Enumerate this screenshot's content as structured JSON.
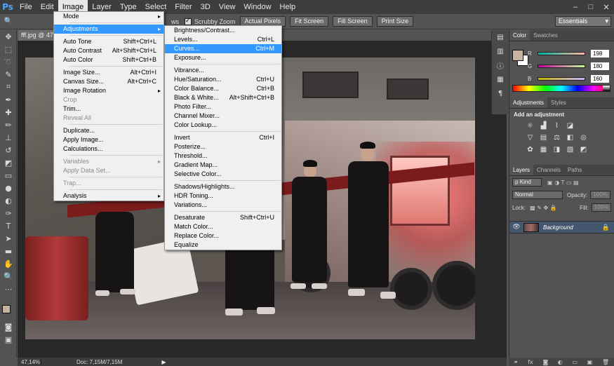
{
  "app": {
    "logo": "Ps"
  },
  "menubar": [
    "File",
    "Edit",
    "Image",
    "Layer",
    "Type",
    "Select",
    "Filter",
    "3D",
    "View",
    "Window",
    "Help"
  ],
  "window_controls": [
    "–",
    "□",
    "✕"
  ],
  "options_bar": {
    "zoom_text": "ws",
    "scrubby_zoom": "Scrubby Zoom",
    "buttons": [
      "Actual Pixels",
      "Fit Screen",
      "Fill Screen",
      "Print Size"
    ],
    "workspace": "Essentials"
  },
  "document_tab": "fff.jpg @ 47",
  "image_menu": {
    "items": [
      {
        "label": "Mode",
        "shortcut": "",
        "submenu": true
      },
      {
        "sep": true
      },
      {
        "label": "Adjustments",
        "shortcut": "",
        "submenu": true,
        "highlight": true
      },
      {
        "sep": true
      },
      {
        "label": "Auto Tone",
        "shortcut": "Shift+Ctrl+L"
      },
      {
        "label": "Auto Contrast",
        "shortcut": "Alt+Shift+Ctrl+L"
      },
      {
        "label": "Auto Color",
        "shortcut": "Shift+Ctrl+B"
      },
      {
        "sep": true
      },
      {
        "label": "Image Size...",
        "shortcut": "Alt+Ctrl+I"
      },
      {
        "label": "Canvas Size...",
        "shortcut": "Alt+Ctrl+C"
      },
      {
        "label": "Image Rotation",
        "shortcut": "",
        "submenu": true
      },
      {
        "label": "Crop",
        "shortcut": "",
        "disabled": true
      },
      {
        "label": "Trim...",
        "shortcut": ""
      },
      {
        "label": "Reveal All",
        "shortcut": "",
        "disabled": true
      },
      {
        "sep": true
      },
      {
        "label": "Duplicate...",
        "shortcut": ""
      },
      {
        "label": "Apply Image...",
        "shortcut": ""
      },
      {
        "label": "Calculations...",
        "shortcut": ""
      },
      {
        "sep": true
      },
      {
        "label": "Variables",
        "shortcut": "",
        "submenu": true,
        "disabled": true
      },
      {
        "label": "Apply Data Set...",
        "shortcut": "",
        "disabled": true
      },
      {
        "sep": true
      },
      {
        "label": "Trap...",
        "shortcut": "",
        "disabled": true
      },
      {
        "sep": true
      },
      {
        "label": "Analysis",
        "shortcut": "",
        "submenu": true
      }
    ]
  },
  "adjustments_menu": {
    "items": [
      {
        "label": "Brightness/Contrast...",
        "shortcut": ""
      },
      {
        "label": "Levels...",
        "shortcut": "Ctrl+L"
      },
      {
        "label": "Curves...",
        "shortcut": "Ctrl+M",
        "highlight": true
      },
      {
        "label": "Exposure...",
        "shortcut": ""
      },
      {
        "sep": true
      },
      {
        "label": "Vibrance...",
        "shortcut": ""
      },
      {
        "label": "Hue/Saturation...",
        "shortcut": "Ctrl+U"
      },
      {
        "label": "Color Balance...",
        "shortcut": "Ctrl+B"
      },
      {
        "label": "Black & White...",
        "shortcut": "Alt+Shift+Ctrl+B"
      },
      {
        "label": "Photo Filter...",
        "shortcut": ""
      },
      {
        "label": "Channel Mixer...",
        "shortcut": ""
      },
      {
        "label": "Color Lookup...",
        "shortcut": ""
      },
      {
        "sep": true
      },
      {
        "label": "Invert",
        "shortcut": "Ctrl+I"
      },
      {
        "label": "Posterize...",
        "shortcut": ""
      },
      {
        "label": "Threshold...",
        "shortcut": ""
      },
      {
        "label": "Gradient Map...",
        "shortcut": ""
      },
      {
        "label": "Selective Color...",
        "shortcut": ""
      },
      {
        "sep": true
      },
      {
        "label": "Shadows/Highlights...",
        "shortcut": ""
      },
      {
        "label": "HDR Toning...",
        "shortcut": ""
      },
      {
        "label": "Variations...",
        "shortcut": ""
      },
      {
        "sep": true
      },
      {
        "label": "Desaturate",
        "shortcut": "Shift+Ctrl+U"
      },
      {
        "label": "Match Color...",
        "shortcut": ""
      },
      {
        "label": "Replace Color...",
        "shortcut": ""
      },
      {
        "label": "Equalize",
        "shortcut": ""
      }
    ]
  },
  "status_bar": {
    "zoom": "47,14%",
    "doc": "Doc: 7,15M/7,15M",
    "arrow": "▶"
  },
  "color_panel": {
    "tabs": [
      "Color",
      "Swatches"
    ],
    "foreground": "#c6b4a0",
    "channels": [
      {
        "label": "R",
        "value": "198"
      },
      {
        "label": "G",
        "value": "180"
      },
      {
        "label": "B",
        "value": "160"
      }
    ]
  },
  "adjustments_panel": {
    "tabs": [
      "Adjustments",
      "Styles"
    ],
    "title": "Add an adjustment"
  },
  "layers_panel": {
    "tabs": [
      "Layers",
      "Channels",
      "Paths"
    ],
    "kind": "Kind",
    "blend_mode": "Normal",
    "opacity_label": "Opacity:",
    "opacity_value": "100%",
    "lock_label": "Lock:",
    "fill_label": "Fill:",
    "fill_value": "100%",
    "layer_name": "Background"
  }
}
